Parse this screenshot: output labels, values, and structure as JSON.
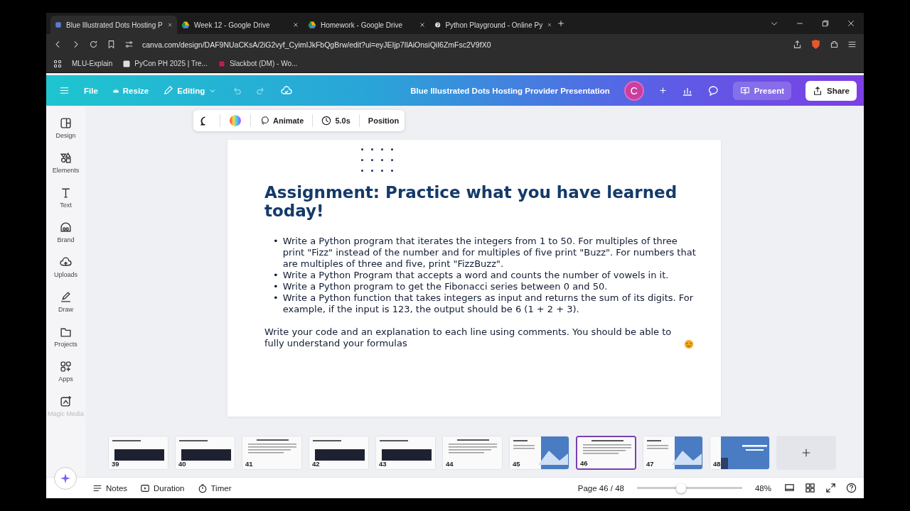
{
  "browser": {
    "tabs": [
      {
        "title": "Blue Illustrated Dots Hosting P",
        "selected": true
      },
      {
        "title": "Week 12 - Google Drive",
        "selected": false
      },
      {
        "title": "Homework - Google Drive",
        "selected": false
      },
      {
        "title": "Python Playground - Online Py",
        "selected": false
      }
    ],
    "address": "canva.com/design/DAF9NUaCKsA/2iG2vyf_CyimIJkFbQgBrw/edit?ui=eyJEIjp7IlAiOnsiQiI6ZmFsc2V9fX0",
    "bookmarks": [
      "MLU-Explain",
      "PyCon PH 2025 | Tre...",
      "Slackbot (DM) - Wo..."
    ]
  },
  "header": {
    "file": "File",
    "resize": "Resize",
    "editing": "Editing",
    "title": "Blue Illustrated Dots Hosting Provider Presentation",
    "avatar": "C",
    "present": "Present",
    "share": "Share"
  },
  "toolbar": {
    "animate": "Animate",
    "duration": "5.0s",
    "position": "Position"
  },
  "sidebar": [
    {
      "label": "Design",
      "disabled": false
    },
    {
      "label": "Elements",
      "disabled": false
    },
    {
      "label": "Text",
      "disabled": false
    },
    {
      "label": "Brand",
      "disabled": false
    },
    {
      "label": "Uploads",
      "disabled": false
    },
    {
      "label": "Draw",
      "disabled": false
    },
    {
      "label": "Projects",
      "disabled": false
    },
    {
      "label": "Apps",
      "disabled": false
    },
    {
      "label": "Magic Media",
      "disabled": true
    }
  ],
  "slide": {
    "title": "Assignment: Practice what you have learned today!",
    "bullets": [
      {
        "marker": "•",
        "text": "Write a Python program that iterates the integers from 1 to 50. For multiples of three print \"Fizz\" instead of the number and for multiples of five print \"Buzz\". For numbers that are multiples of three and five, print \"FizzBuzz\"."
      },
      {
        "marker": "•",
        "text": "Write a Python Program that accepts a word and counts the number of vowels in it."
      },
      {
        "marker": "•",
        "text": "Write a Python program to get the Fibonacci series between 0 and 50."
      },
      {
        "marker": "•",
        "text": "Write a Python function that takes integers as input and returns the sum of its digits. For example, if the input is 123, the output should be 6 (1 + 2 + 3)."
      }
    ],
    "note": "Write your code and an explanation to each line using comments. You should be able to fully understand your formulas"
  },
  "thumbnails": [
    {
      "number": "39",
      "kind": "dark",
      "selected": false
    },
    {
      "number": "40",
      "kind": "dark",
      "selected": false
    },
    {
      "number": "41",
      "kind": "light",
      "selected": false
    },
    {
      "number": "42",
      "kind": "dark",
      "selected": false
    },
    {
      "number": "43",
      "kind": "dark",
      "selected": false
    },
    {
      "number": "44",
      "kind": "light",
      "selected": false
    },
    {
      "number": "45",
      "kind": "split",
      "selected": false
    },
    {
      "number": "46",
      "kind": "light",
      "selected": true
    },
    {
      "number": "47",
      "kind": "split",
      "selected": false
    },
    {
      "number": "48",
      "kind": "blue",
      "selected": false
    }
  ],
  "footer": {
    "notes": "Notes",
    "duration": "Duration",
    "timer": "Timer",
    "page": "Page 46 / 48",
    "zoom": {
      "level": 0.41
    },
    "zoom_text": "48%"
  }
}
